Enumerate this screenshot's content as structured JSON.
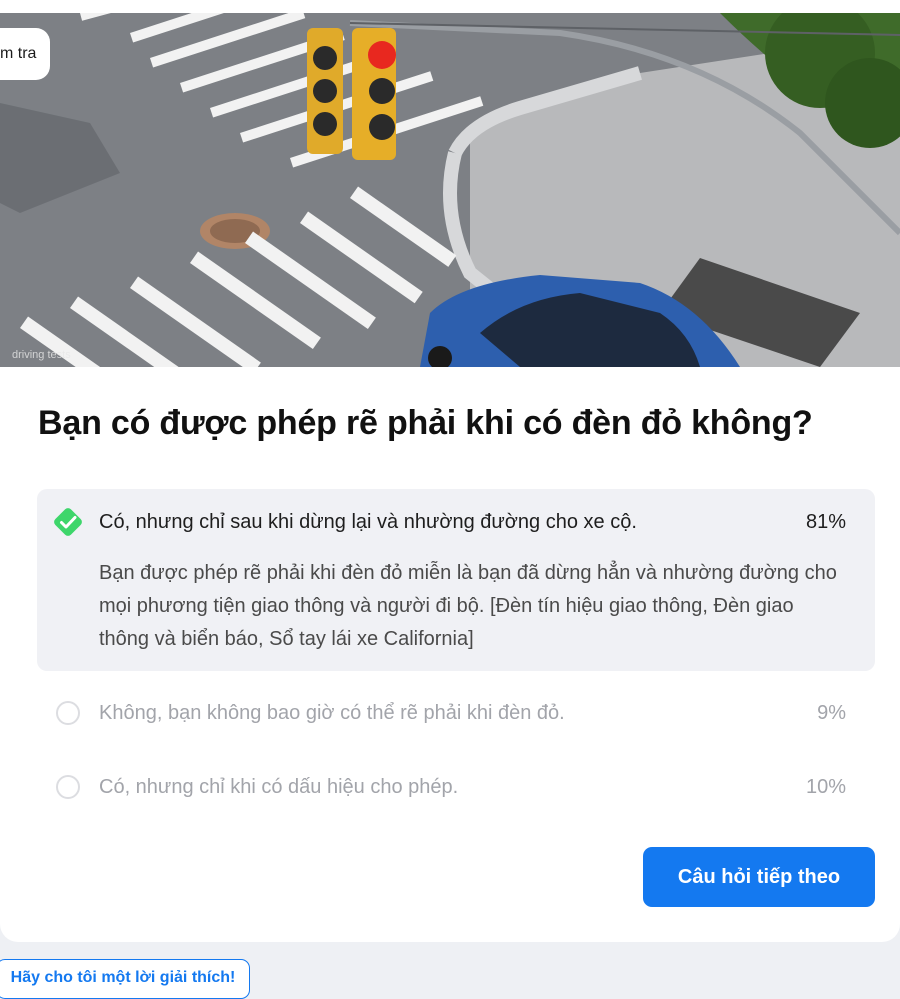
{
  "hero": {
    "pill_text": "m tra",
    "watermark": "driving tests"
  },
  "question": "Bạn có được phép rẽ phải khi có đèn đỏ không?",
  "options": [
    {
      "text": "Có, nhưng chỉ sau khi dừng lại và nhường đường cho xe cộ.",
      "percent": "81%",
      "state": "correct"
    },
    {
      "text": "Không, bạn không bao giờ có thể rẽ phải khi đèn đỏ.",
      "percent": "9%",
      "state": "unselected"
    },
    {
      "text": "Có, nhưng chỉ khi có dấu hiệu cho phép.",
      "percent": "10%",
      "state": "unselected"
    }
  ],
  "explanation": "Bạn được phép rẽ phải khi đèn đỏ miễn là bạn đã dừng hẳn và nhường đường cho mọi phương tiện giao thông và người đi bộ. [Đèn tín hiệu giao thông, Đèn giao thông và biển báo, Sổ tay lái xe California]",
  "buttons": {
    "next": "Câu hỏi tiếp theo",
    "explain": "Hãy cho tôi một lời giải thích!"
  },
  "colors": {
    "accent": "#1479f0",
    "correct": "#3ed66b",
    "answer_bg": "#f0f1f5"
  },
  "icons": {
    "correct": "check-icon",
    "unselected": "radio-circle-icon"
  }
}
